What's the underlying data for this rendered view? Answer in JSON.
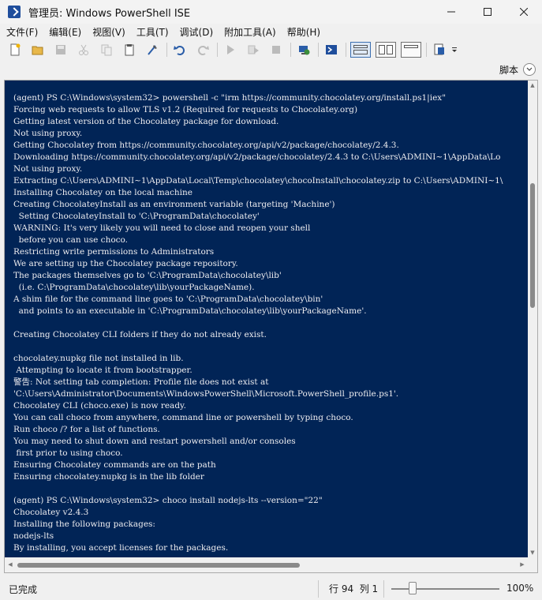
{
  "window": {
    "title": "管理员: Windows PowerShell ISE",
    "controls": [
      "minimize-icon",
      "maximize-icon",
      "close-icon"
    ]
  },
  "menu": [
    {
      "label": "文件(F)"
    },
    {
      "label": "编辑(E)"
    },
    {
      "label": "视图(V)"
    },
    {
      "label": "工具(T)"
    },
    {
      "label": "调试(D)"
    },
    {
      "label": "附加工具(A)"
    },
    {
      "label": "帮助(H)"
    }
  ],
  "toolbar": {
    "icons": [
      "new-file-icon",
      "open-file-icon",
      "save-icon",
      "cut-icon",
      "copy-icon",
      "paste-icon",
      "clear-console-icon",
      "undo-icon",
      "redo-icon",
      "run-script-icon",
      "run-selection-icon",
      "stop-icon",
      "new-remote-tab-icon",
      "start-powershell-icon",
      "pane-top-icon",
      "pane-right-icon",
      "pane-max-icon",
      "show-commands-icon",
      "toolbar-overflow-icon"
    ]
  },
  "script_pane": {
    "label": "脚本",
    "collapse_icon": "chevron-down-icon"
  },
  "console": {
    "lines": [
      "(agent) PS C:\\Windows\\system32> powershell -c \"irm https://community.chocolatey.org/install.ps1|iex\"",
      "Forcing web requests to allow TLS v1.2 (Required for requests to Chocolatey.org)",
      "Getting latest version of the Chocolatey package for download.",
      "Not using proxy.",
      "Getting Chocolatey from https://community.chocolatey.org/api/v2/package/chocolatey/2.4.3.",
      "Downloading https://community.chocolatey.org/api/v2/package/chocolatey/2.4.3 to C:\\Users\\ADMINI~1\\AppData\\Lo",
      "Not using proxy.",
      "Extracting C:\\Users\\ADMINI~1\\AppData\\Local\\Temp\\chocolatey\\chocoInstall\\chocolatey.zip to C:\\Users\\ADMINI~1\\",
      "Installing Chocolatey on the local machine",
      "Creating ChocolateyInstall as an environment variable (targeting 'Machine')",
      "  Setting ChocolateyInstall to 'C:\\ProgramData\\chocolatey'",
      "WARNING: It's very likely you will need to close and reopen your shell",
      "  before you can use choco.",
      "Restricting write permissions to Administrators",
      "We are setting up the Chocolatey package repository.",
      "The packages themselves go to 'C:\\ProgramData\\chocolatey\\lib'",
      "  (i.e. C:\\ProgramData\\chocolatey\\lib\\yourPackageName).",
      "A shim file for the command line goes to 'C:\\ProgramData\\chocolatey\\bin'",
      "  and points to an executable in 'C:\\ProgramData\\chocolatey\\lib\\yourPackageName'.",
      "",
      "Creating Chocolatey CLI folders if they do not already exist.",
      "",
      "chocolatey.nupkg file not installed in lib.",
      " Attempting to locate it from bootstrapper.",
      "警告: Not setting tab completion: Profile file does not exist at",
      "'C:\\Users\\Administrator\\Documents\\WindowsPowerShell\\Microsoft.PowerShell_profile.ps1'.",
      "Chocolatey CLI (choco.exe) is now ready.",
      "You can call choco from anywhere, command line or powershell by typing choco.",
      "Run choco /? for a list of functions.",
      "You may need to shut down and restart powershell and/or consoles",
      " first prior to using choco.",
      "Ensuring Chocolatey commands are on the path",
      "Ensuring chocolatey.nupkg is in the lib folder",
      "",
      "(agent) PS C:\\Windows\\system32> choco install nodejs-lts --version=\"22\"",
      "Chocolatey v2.4.3",
      "Installing the following packages:",
      "nodejs-lts",
      "By installing, you accept licenses for the packages."
    ]
  },
  "status": {
    "text": "已完成",
    "position": "行 94  列 1",
    "zoom_label": "100%",
    "zoom_level_fraction": 0.2
  }
}
